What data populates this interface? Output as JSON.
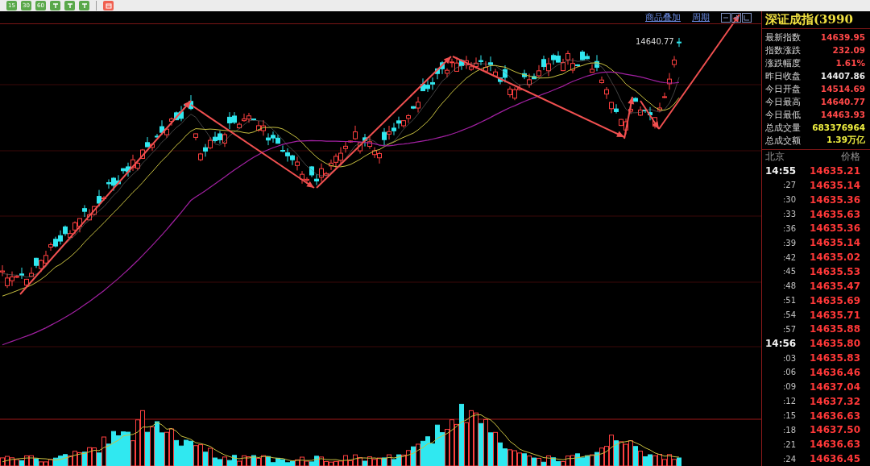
{
  "toolbar": {
    "buttons": [
      {
        "kind": "text",
        "label": "15"
      },
      {
        "kind": "text",
        "label": "30"
      },
      {
        "kind": "text",
        "label": "60"
      },
      {
        "kind": "icon"
      },
      {
        "kind": "icon"
      },
      {
        "kind": "icon"
      },
      {
        "kind": "calendar"
      }
    ]
  },
  "chart": {
    "links": [
      "商品叠加",
      "周期"
    ],
    "high_label": "14640.77"
  },
  "quote": {
    "title": "深证成指(3990",
    "stats": [
      {
        "label": "最新指数",
        "value": "14639.95",
        "color": "#ff4848"
      },
      {
        "label": "指数涨跌",
        "value": "232.09",
        "color": "#ff4848"
      },
      {
        "label": "涨跌幅度",
        "value": "1.61%",
        "color": "#ff4848"
      },
      {
        "label": "昨日收盘",
        "value": "14407.86",
        "color": "#e8e8e8"
      },
      {
        "label": "今日开盘",
        "value": "14514.69",
        "color": "#ff4848"
      },
      {
        "label": "今日最高",
        "value": "14640.77",
        "color": "#ff4848"
      },
      {
        "label": "今日最低",
        "value": "14463.93",
        "color": "#ff4848"
      },
      {
        "label": "总成交量",
        "value": "683376964",
        "color": "#f0f040"
      },
      {
        "label": "总成交额",
        "value": "1.39万亿",
        "color": "#f0f040"
      }
    ],
    "ticks_header": {
      "time": "北京",
      "price": "价格"
    },
    "ticks": [
      {
        "kind": "minute",
        "time": "14:55",
        "price": "14635.21"
      },
      {
        "kind": "second",
        "time": ":27",
        "price": "14635.14"
      },
      {
        "kind": "second",
        "time": ":30",
        "price": "14635.36"
      },
      {
        "kind": "second",
        "time": ":33",
        "price": "14635.63"
      },
      {
        "kind": "second",
        "time": ":36",
        "price": "14635.36"
      },
      {
        "kind": "second",
        "time": ":39",
        "price": "14635.14"
      },
      {
        "kind": "second",
        "time": ":42",
        "price": "14635.02"
      },
      {
        "kind": "second",
        "time": ":45",
        "price": "14635.53"
      },
      {
        "kind": "second",
        "time": ":48",
        "price": "14635.47"
      },
      {
        "kind": "second",
        "time": ":51",
        "price": "14635.69"
      },
      {
        "kind": "second",
        "time": ":54",
        "price": "14635.71"
      },
      {
        "kind": "second",
        "time": ":57",
        "price": "14635.88"
      },
      {
        "kind": "minute",
        "time": "14:56",
        "price": "14635.80"
      },
      {
        "kind": "second",
        "time": ":03",
        "price": "14635.83"
      },
      {
        "kind": "second",
        "time": ":06",
        "price": "14636.46"
      },
      {
        "kind": "second",
        "time": ":09",
        "price": "14637.04"
      },
      {
        "kind": "second",
        "time": ":12",
        "price": "14637.32"
      },
      {
        "kind": "second",
        "time": ":15",
        "price": "14636.63"
      },
      {
        "kind": "second",
        "time": ":18",
        "price": "14637.50"
      },
      {
        "kind": "second",
        "time": ":21",
        "price": "14636.63"
      },
      {
        "kind": "second",
        "time": ":24",
        "price": "14636.45"
      }
    ]
  }
}
